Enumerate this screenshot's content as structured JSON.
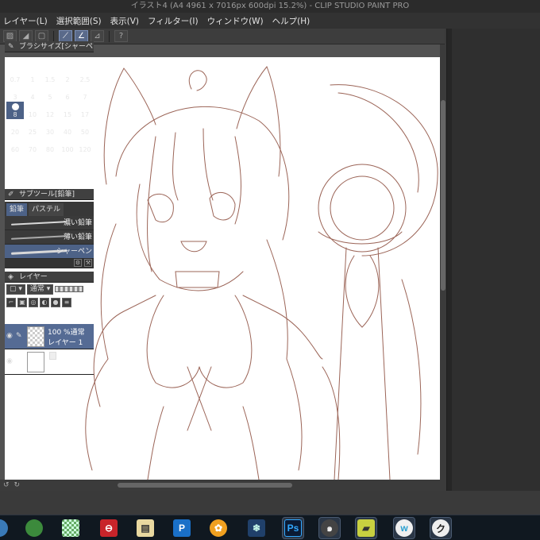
{
  "window": {
    "title": "イラスト4 (A4 4961 x 7016px 600dpi 15.2%) - CLIP STUDIO PAINT PRO"
  },
  "menu": [
    "レイヤー(L)",
    "選択範囲(S)",
    "表示(V)",
    "フィルター(I)",
    "ウィンドウ(W)",
    "ヘルプ(H)"
  ],
  "brush_size_panel": {
    "title": "ブラシサイズ[シャーペン",
    "sizes": [
      "0.7",
      "1",
      "1.5",
      "2",
      "2.5",
      "3",
      "4",
      "5",
      "6",
      "7",
      "8",
      "10",
      "12",
      "15",
      "17",
      "20",
      "25",
      "30",
      "40",
      "50",
      "60",
      "70",
      "80",
      "100",
      "120"
    ],
    "selected": "8"
  },
  "subtool_panel": {
    "title": "サブツール[鉛筆]",
    "tabs": [
      "鉛筆",
      "パステル"
    ],
    "items": [
      "濃い鉛筆",
      "薄い鉛筆",
      "シャーペン"
    ],
    "selected_item": "シャーペン"
  },
  "layer_panel": {
    "title": "レイヤー",
    "blend_mode": "通常",
    "layers": [
      {
        "opacity_mode": "100 %通常",
        "name": "レイヤー 1"
      },
      {
        "name": "用紙"
      }
    ]
  }
}
